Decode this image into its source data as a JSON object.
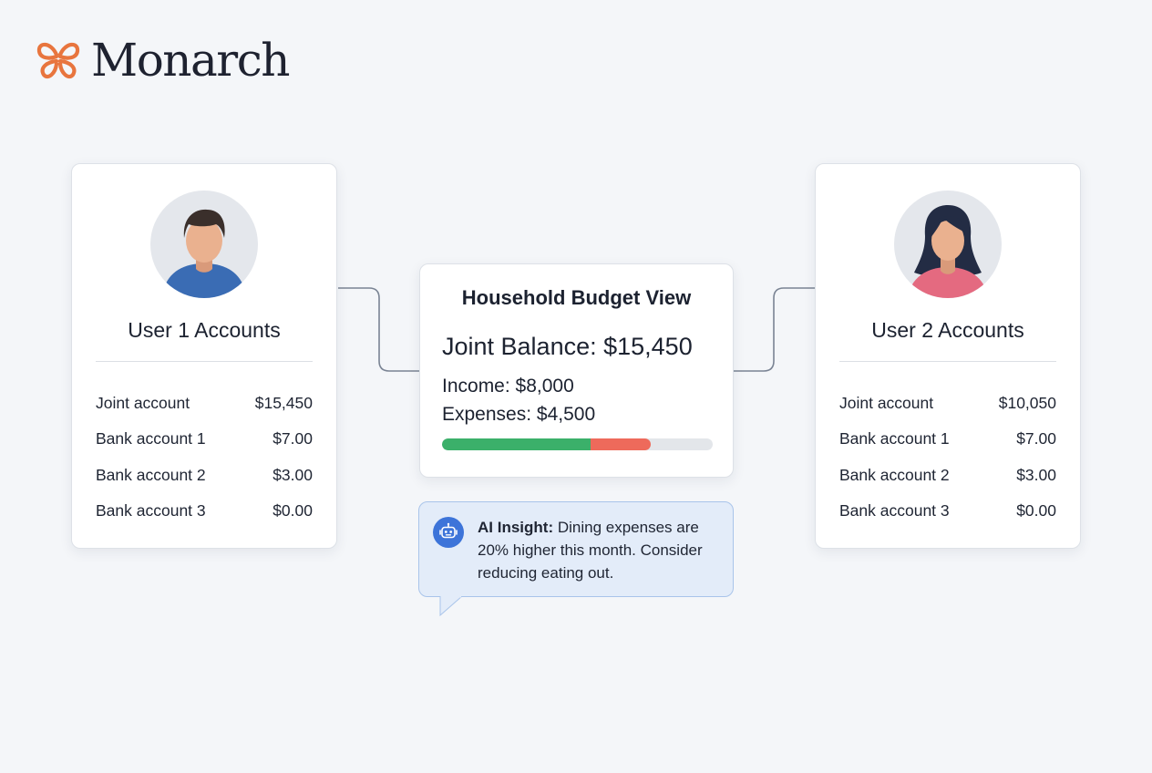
{
  "brand": {
    "name": "Monarch",
    "logo_icon": "butterfly-icon",
    "accent_color": "#e8753e"
  },
  "user1": {
    "title": "User 1 Accounts",
    "avatar_icon": "male-avatar-icon",
    "accounts": [
      {
        "name": "Joint account",
        "amount": "$15,450"
      },
      {
        "name": "Bank account 1",
        "amount": "$7.00"
      },
      {
        "name": "Bank account 2",
        "amount": "$3.00"
      },
      {
        "name": "Bank account 3",
        "amount": "$0.00"
      }
    ]
  },
  "user2": {
    "title": "User 2 Accounts",
    "avatar_icon": "female-avatar-icon",
    "accounts": [
      {
        "name": "Joint account",
        "amount": "$10,050"
      },
      {
        "name": "Bank account 1",
        "amount": "$7.00"
      },
      {
        "name": "Bank account 2",
        "amount": "$3.00"
      },
      {
        "name": "Bank account 3",
        "amount": "$0.00"
      }
    ]
  },
  "budget": {
    "title": "Household Budget View",
    "joint_balance": "Joint Balance: $15,450",
    "income": "Income: $8,000",
    "expenses": "Expenses: $4,500",
    "bar": {
      "income_fraction": 0.55,
      "expense_fraction": 0.22,
      "income_color": "#3bb06a",
      "expense_color": "#ee6a5b"
    }
  },
  "insight": {
    "icon": "robot-icon",
    "label": "AI Insight:",
    "text": " Dining expenses are 20% higher this month. Consider reducing eating out."
  }
}
